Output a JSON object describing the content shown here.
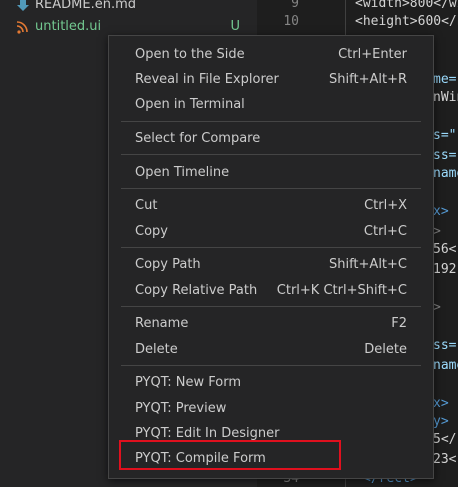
{
  "explorer": {
    "files": [
      {
        "name": "README.en.md",
        "status": ""
      },
      {
        "name": "untitled.ui",
        "status": "U"
      }
    ]
  },
  "editor": {
    "line_numbers": [
      "9",
      "10",
      "34"
    ],
    "code_fragments": [
      {
        "line": "<width>800</wi"
      },
      {
        "line": "<height>600</h"
      }
    ],
    "partial_text": [
      "me=",
      "nWin",
      "s=\"(",
      "ss=",
      "name",
      "x>",
      ">",
      "56<",
      "192",
      ">",
      "ss=",
      "name",
      "x>",
      "y>",
      "5</",
      "23<",
      "</rect>"
    ]
  },
  "context_menu": {
    "groups": [
      [
        {
          "label": "Open to the Side",
          "shortcut": "Ctrl+Enter"
        },
        {
          "label": "Reveal in File Explorer",
          "shortcut": "Shift+Alt+R"
        },
        {
          "label": "Open in Terminal",
          "shortcut": ""
        }
      ],
      [
        {
          "label": "Select for Compare",
          "shortcut": ""
        }
      ],
      [
        {
          "label": "Open Timeline",
          "shortcut": ""
        }
      ],
      [
        {
          "label": "Cut",
          "shortcut": "Ctrl+X"
        },
        {
          "label": "Copy",
          "shortcut": "Ctrl+C"
        }
      ],
      [
        {
          "label": "Copy Path",
          "shortcut": "Shift+Alt+C"
        },
        {
          "label": "Copy Relative Path",
          "shortcut": "Ctrl+K Ctrl+Shift+C"
        }
      ],
      [
        {
          "label": "Rename",
          "shortcut": "F2"
        },
        {
          "label": "Delete",
          "shortcut": "Delete"
        }
      ],
      [
        {
          "label": "PYQT: New Form",
          "shortcut": ""
        },
        {
          "label": "PYQT: Preview",
          "shortcut": ""
        },
        {
          "label": "PYQT: Edit In Designer",
          "shortcut": ""
        },
        {
          "label": "PYQT: Compile Form",
          "shortcut": ""
        }
      ]
    ]
  },
  "colors": {
    "git_untracked": "#73c991",
    "highlight_box": "#e0101e",
    "menu_bg": "#252526"
  },
  "icons": {
    "readme": "markdown-download-icon",
    "untitled": "rss-feed-icon"
  }
}
